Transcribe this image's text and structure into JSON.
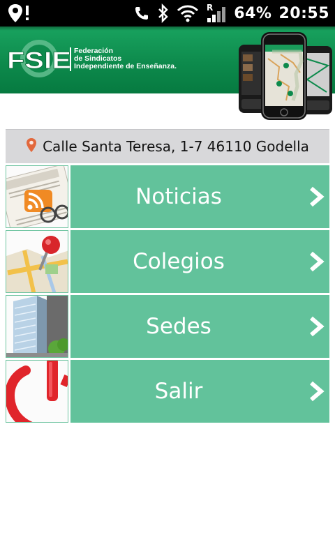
{
  "status_bar": {
    "battery_percent": "64%",
    "time": "20:55",
    "icons": [
      "location-alert-icon",
      "call-icon",
      "bluetooth-icon",
      "wifi-icon",
      "signal-roaming-icon"
    ]
  },
  "header": {
    "logo_text": "FSIE",
    "brand_lines": [
      "Federación",
      "de Sindicatos",
      "Independiente de Enseñanza."
    ],
    "accent_color": "#0d8a4c"
  },
  "address": {
    "text": "Calle Santa Teresa, 1-7 46110 Godella",
    "icon": "map-pin-icon"
  },
  "menu": [
    {
      "label": "Noticias",
      "thumb_icon": "news-rss-icon"
    },
    {
      "label": "Colegios",
      "thumb_icon": "map-pushpin-icon"
    },
    {
      "label": "Sedes",
      "thumb_icon": "building-icon"
    },
    {
      "label": "Salir",
      "thumb_icon": "power-icon"
    }
  ],
  "colors": {
    "menu_button": "#62c29b",
    "address_bar": "#d8d8da"
  }
}
